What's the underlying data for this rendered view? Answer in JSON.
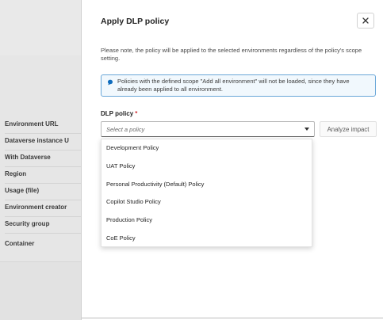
{
  "background": {
    "side_labels": [
      "Environment URL",
      "Dataverse instance U",
      "With Dataverse",
      "Region",
      "Usage (file)",
      "Environment creator",
      "Security group",
      "Container"
    ]
  },
  "dialog": {
    "title": "Apply DLP policy",
    "close_icon": "close-icon",
    "note": "Please note, the policy will be applied to the selected environments regardless of the policy's scope setting.",
    "info_icon": "info-icon",
    "info_text": "Policies with the defined scope \"Add all environment\" will not be loaded, since they have already been applied to all environment.",
    "field_label": "DLP policy",
    "required_mark": "*",
    "select_placeholder": "Select a policy",
    "analyze_button": "Analyze impact",
    "options": [
      "Development Policy",
      "UAT Policy",
      "Personal Productivity (Default) Policy",
      "Copilot Studio Policy",
      "Production Policy",
      "CoE Policy"
    ]
  },
  "colors": {
    "info_border": "#6aa7d8",
    "info_bg": "#f1f8fd",
    "required": "#d13438",
    "info_icon": "#0f6cbd"
  }
}
